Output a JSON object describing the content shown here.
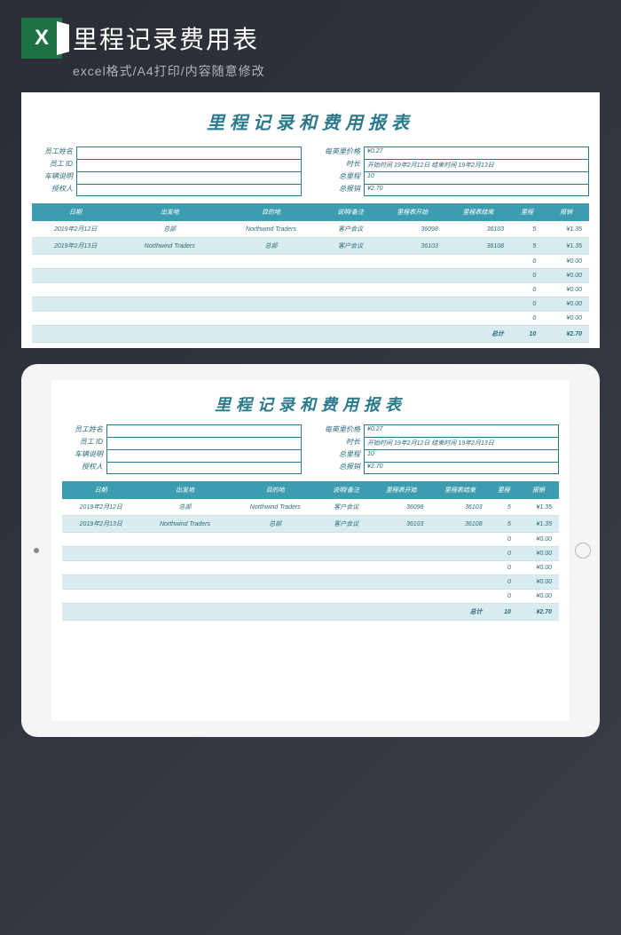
{
  "banner": {
    "title": "里程记录费用表",
    "subtitle": "excel格式/A4打印/内容随意修改",
    "icon_letter": "X"
  },
  "sheet": {
    "title": "里程记录和费用报表",
    "left_labels": {
      "emp_name": "员工姓名",
      "emp_id": "员工 ID",
      "vehicle": "车辆说明",
      "authorizer": "授权人"
    },
    "right_labels": {
      "rate": "每英里价格",
      "duration": "时长",
      "total_miles": "总里程",
      "total_reimb": "总报销"
    },
    "right_values": {
      "rate": "¥0.27",
      "duration": "开始时间 19年2月12日 结束时间 19年2月13日",
      "total_miles": "10",
      "total_reimb": "¥2.70"
    },
    "columns": [
      "日期",
      "出发地",
      "目的地",
      "说明/备注",
      "里程表开始",
      "里程表结束",
      "里程",
      "报销"
    ],
    "rows": [
      {
        "date": "2019年2月12日",
        "from": "总部",
        "to": "Northwind Traders",
        "note": "客户会议",
        "start": "36098",
        "end": "36103",
        "miles": "5",
        "reimb": "¥1.35"
      },
      {
        "date": "2019年2月13日",
        "from": "Northwind Traders",
        "to": "总部",
        "note": "客户会议",
        "start": "36103",
        "end": "36108",
        "miles": "5",
        "reimb": "¥1.35"
      },
      {
        "date": "",
        "from": "",
        "to": "",
        "note": "",
        "start": "",
        "end": "",
        "miles": "0",
        "reimb": "¥0.00"
      },
      {
        "date": "",
        "from": "",
        "to": "",
        "note": "",
        "start": "",
        "end": "",
        "miles": "0",
        "reimb": "¥0.00"
      },
      {
        "date": "",
        "from": "",
        "to": "",
        "note": "",
        "start": "",
        "end": "",
        "miles": "0",
        "reimb": "¥0.00"
      },
      {
        "date": "",
        "from": "",
        "to": "",
        "note": "",
        "start": "",
        "end": "",
        "miles": "0",
        "reimb": "¥0.00"
      },
      {
        "date": "",
        "from": "",
        "to": "",
        "note": "",
        "start": "",
        "end": "",
        "miles": "0",
        "reimb": "¥0.00"
      }
    ],
    "total": {
      "label": "总计",
      "miles": "10",
      "reimb": "¥2.70"
    }
  }
}
